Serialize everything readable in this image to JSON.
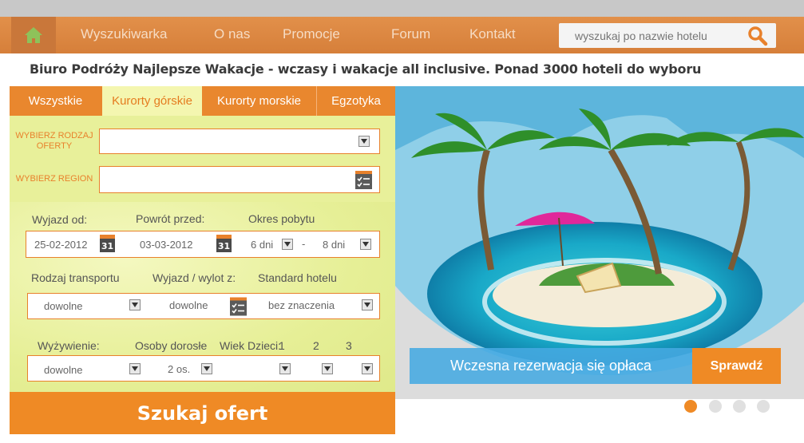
{
  "nav": {
    "home_icon": "home-icon",
    "items": [
      {
        "label": "Wyszukiwarka"
      },
      {
        "label": "O nas"
      },
      {
        "label": "Promocje"
      },
      {
        "label": "Forum"
      },
      {
        "label": "Kontakt"
      }
    ],
    "search": {
      "placeholder": "wyszukaj po nazwie hotelu",
      "icon": "search-icon"
    }
  },
  "tagline": "Biuro Podróży Najlepsze Wakacje - wczasy i wakacje all inclusive. Ponad 3000 hoteli do wyboru",
  "search_panel": {
    "tabs": [
      {
        "label": "Wszystkie",
        "active": false
      },
      {
        "label": "Kurorty górskie",
        "active": true
      },
      {
        "label": "Kurorty morskie",
        "active": false
      },
      {
        "label": "Egzotyka",
        "active": false
      }
    ],
    "offer_type": {
      "label": "WYBIERZ RODZAJ OFERTY",
      "value": ""
    },
    "region": {
      "label": "WYBIERZ REGION",
      "value": ""
    },
    "dates": {
      "depart_label": "Wyjazd od:",
      "return_label": "Powrót przed:",
      "stay_label": "Okres pobytu",
      "depart_value": "25-02-2012",
      "return_value": "03-03-2012",
      "calendar_day": "31",
      "stay_from": "6 dni",
      "stay_sep": "-",
      "stay_to": "8 dni"
    },
    "transport": {
      "transport_label": "Rodzaj transportu",
      "departure_label": "Wyjazd / wylot z:",
      "standard_label": "Standard hotelu",
      "transport_value": "dowolne",
      "departure_value": "dowolne",
      "standard_value": "bez znaczenia"
    },
    "people": {
      "board_label": "Wyżywienie:",
      "adults_label": "Osoby dorosłe",
      "kids_label": "Wiek Dzieci:",
      "kid1_label": "1",
      "kid2_label": "2",
      "kid3_label": "3",
      "board_value": "dowolne",
      "adults_value": "2 os."
    },
    "submit_label": "Szukaj ofert"
  },
  "banner": {
    "caption": "Wczesna rezerwacja się opłaca",
    "button_label": "Sprawdź",
    "slides": 4,
    "active_slide": 1
  },
  "colors": {
    "accent": "#ef8a25",
    "nav": "#d67f3a",
    "panel": "#e8f09a",
    "caption": "#46aae1"
  }
}
